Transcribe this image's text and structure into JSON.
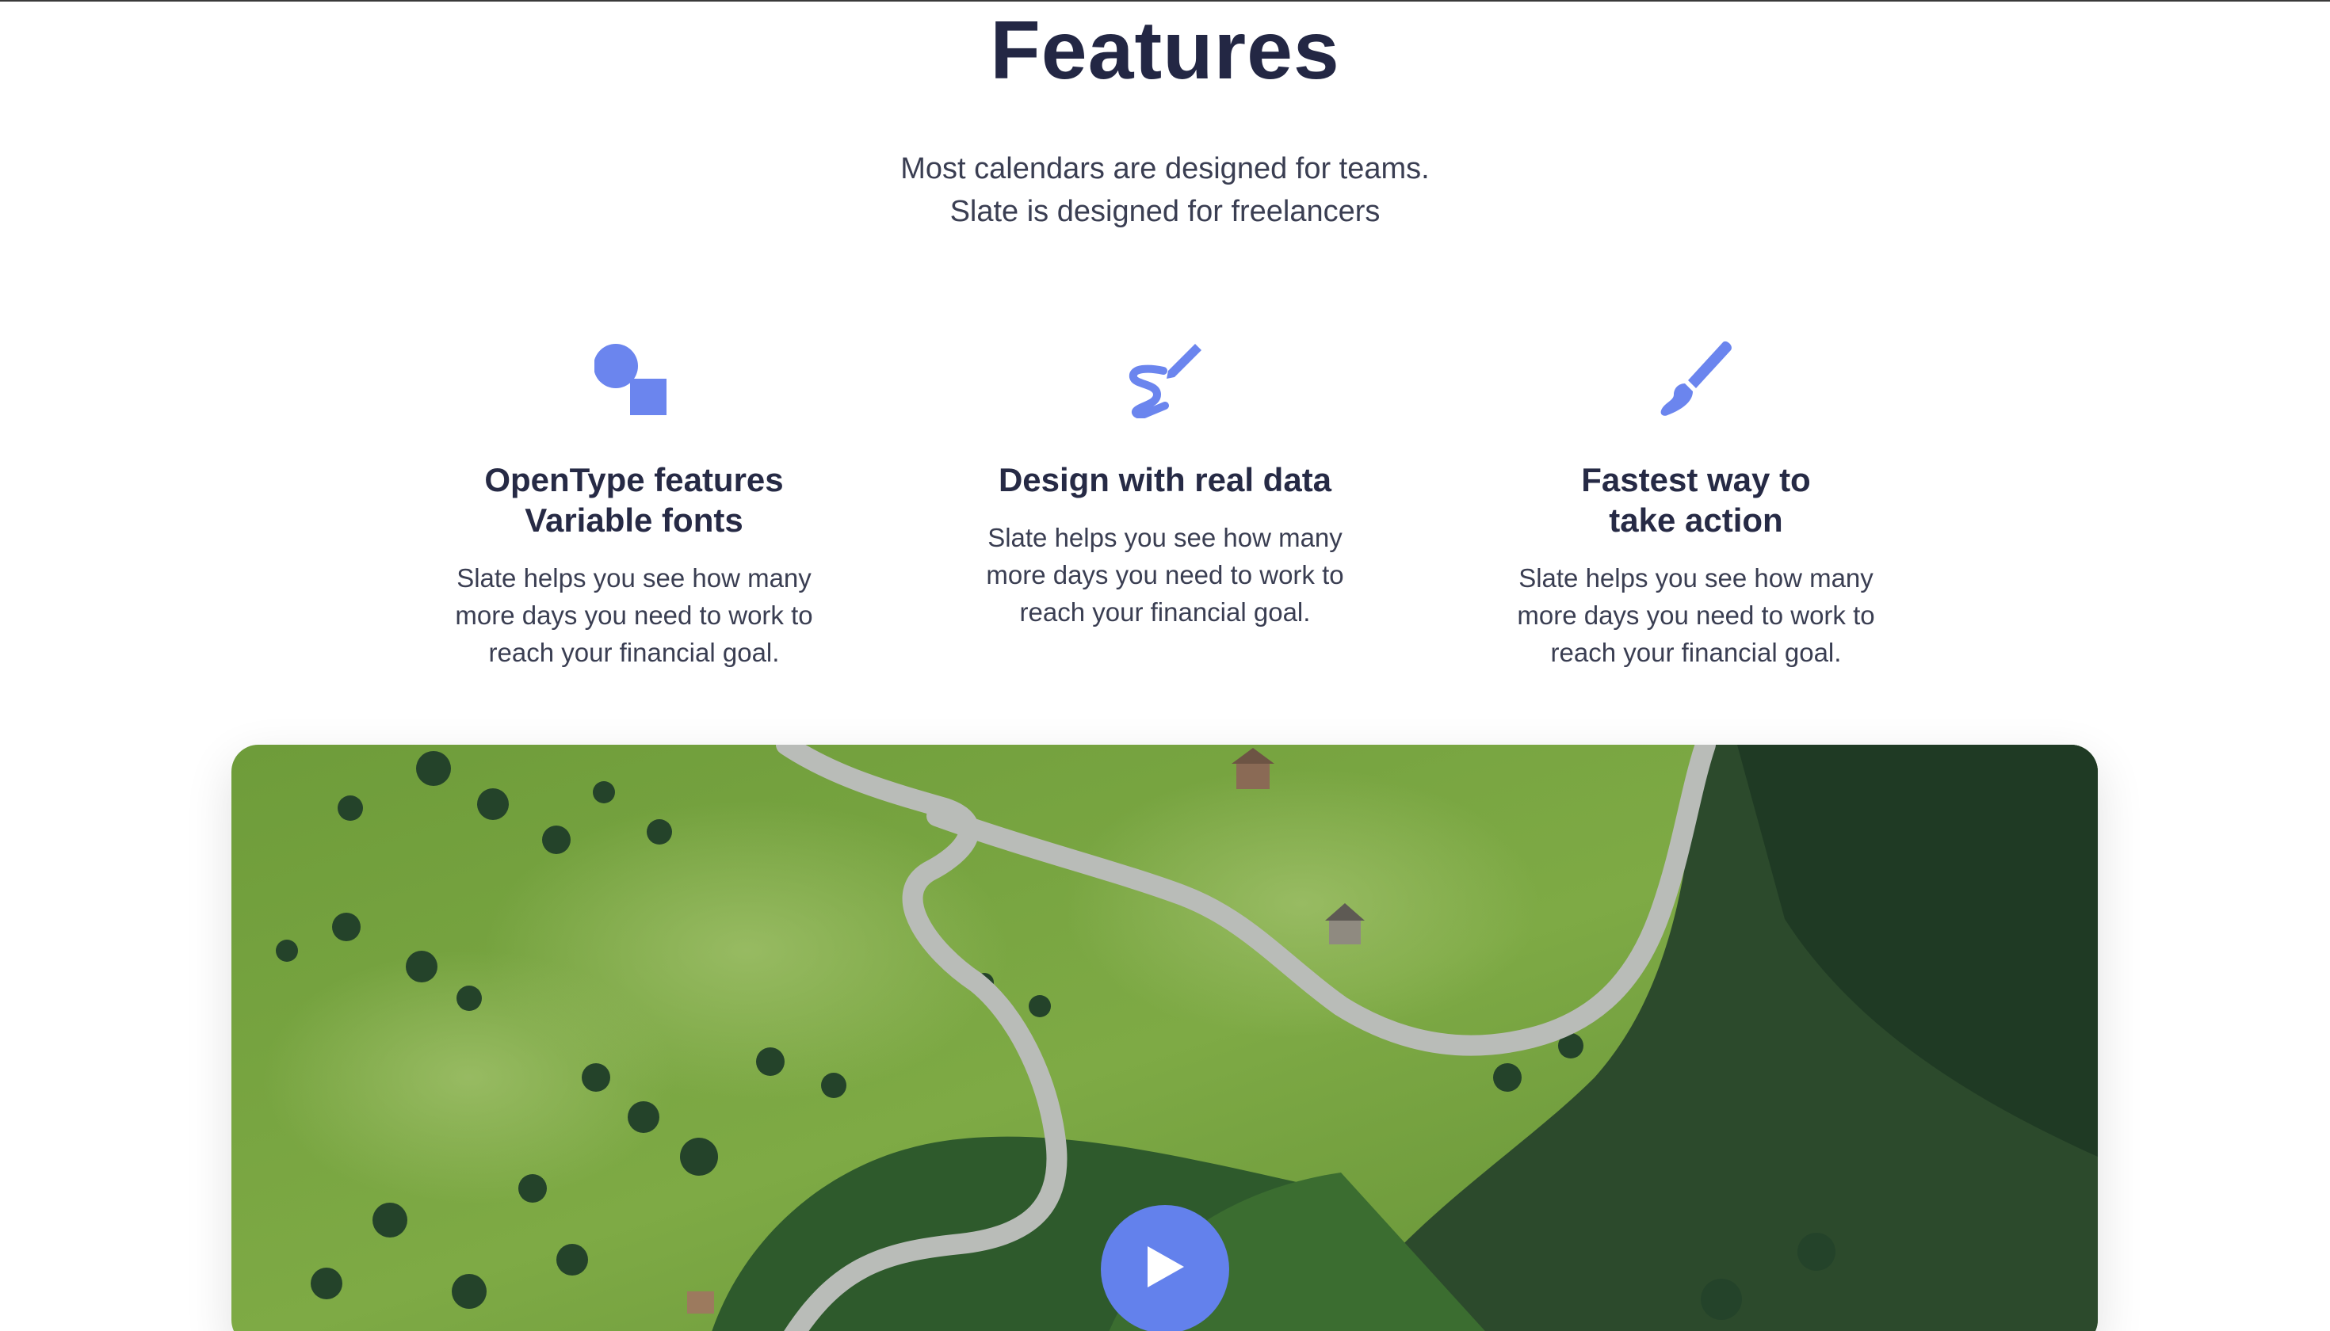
{
  "section": {
    "title": "Features",
    "subtitle_lines": [
      "Most calendars are designed for teams.",
      "Slate is designed for freelancers"
    ]
  },
  "features": [
    {
      "icon": "shapes-icon",
      "title_lines": [
        "OpenType features",
        "Variable fonts"
      ],
      "description": "Slate helps you see how many more days you need to work to reach your financial goal."
    },
    {
      "icon": "pen-squiggle-icon",
      "title_lines": [
        "Design with real data"
      ],
      "description": "Slate helps you see how many more days you need to work to reach your financial goal."
    },
    {
      "icon": "paint-brush-icon",
      "title_lines": [
        "Fastest way to",
        "take action"
      ],
      "description": "Slate helps you see how many more days you need to work to reach your financial goal."
    }
  ],
  "video": {
    "thumbnail": "aerial view of winding road through meadow and forest",
    "play_icon": "play-icon"
  },
  "colors": {
    "accent": "#6b85ee",
    "play_button": "#6381ec",
    "heading": "#232744",
    "body_text": "#3a3e52"
  }
}
